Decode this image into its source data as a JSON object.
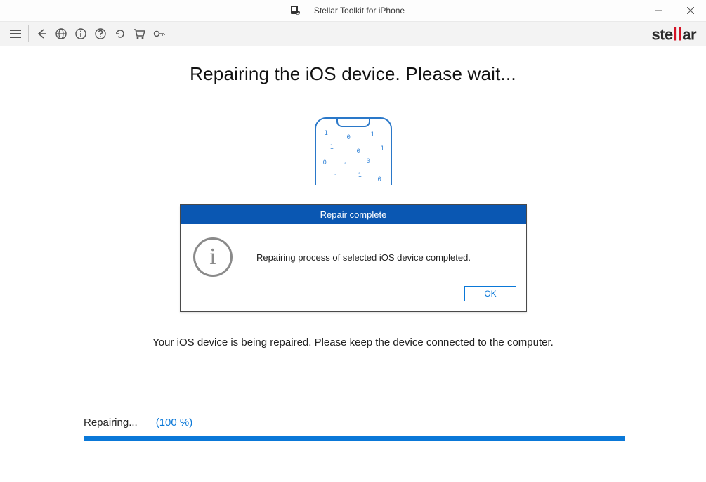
{
  "titlebar": {
    "title": "Stellar Toolkit for iPhone"
  },
  "brand": {
    "text": "stellar"
  },
  "main": {
    "heading": "Repairing the iOS device. Please wait...",
    "hint": "Your iOS device is being repaired. Please keep the device connected to the computer."
  },
  "dialog": {
    "title": "Repair complete",
    "message": "Repairing process of selected iOS device completed.",
    "ok": "OK"
  },
  "progress": {
    "label": "Repairing...",
    "percent_text": "(100 %)",
    "percent": 100
  }
}
